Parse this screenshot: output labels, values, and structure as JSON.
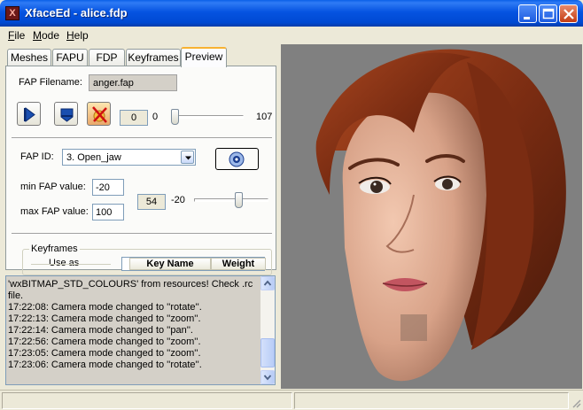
{
  "window": {
    "title": "XfaceEd - alice.fdp",
    "app_icon": "X"
  },
  "menu": [
    {
      "label": "File",
      "accel": "F",
      "rest": "ile"
    },
    {
      "label": "Mode",
      "accel": "M",
      "rest": "ode"
    },
    {
      "label": "Help",
      "accel": "H",
      "rest": "elp"
    }
  ],
  "tabs": [
    "Meshes",
    "FAPU",
    "FDP",
    "Keyframes",
    "Preview"
  ],
  "active_tab": "Preview",
  "preview": {
    "fap_filename_label": "FAP Filename:",
    "fap_filename_value": "anger.fap",
    "frame_value": "0",
    "frame_min": "0",
    "frame_max": "107",
    "frame_slider_fraction": 0.0,
    "fap_id_label": "FAP ID:",
    "fap_id_value": "3. Open_jaw",
    "min_fap_label": "min FAP value:",
    "min_fap_value": "-20",
    "max_fap_label": "max FAP value:",
    "max_fap_value": "100",
    "current_fap_value": "54",
    "fap_slider_min_label": "-20",
    "fap_slider_fraction": 0.61,
    "keyframes_group_label": "Keyframes",
    "use_as_label": "Use as",
    "columns": [
      "Key Name",
      "Weight"
    ]
  },
  "log": {
    "lines": [
      "'wxBITMAP_STD_COLOURS' from resources! Check .rc",
      "file.",
      "17:22:08: Camera mode changed to ''rotate''.",
      "17:22:13: Camera mode changed to ''zoom''.",
      "17:22:14: Camera mode changed to ''pan''.",
      "17:22:56: Camera mode changed to ''zoom''.",
      "17:23:05: Camera mode changed to ''zoom''.",
      "17:23:06: Camera mode changed to ''rotate''."
    ]
  },
  "icons": {
    "play": "play-icon",
    "stop": "stop-icon",
    "clear": "clear-icon",
    "target": "target-icon"
  },
  "colors": {
    "title_bar": "#0553e1",
    "viewport_bg": "#808080",
    "hair": "#8a3418",
    "skin": "#e3b29a"
  }
}
